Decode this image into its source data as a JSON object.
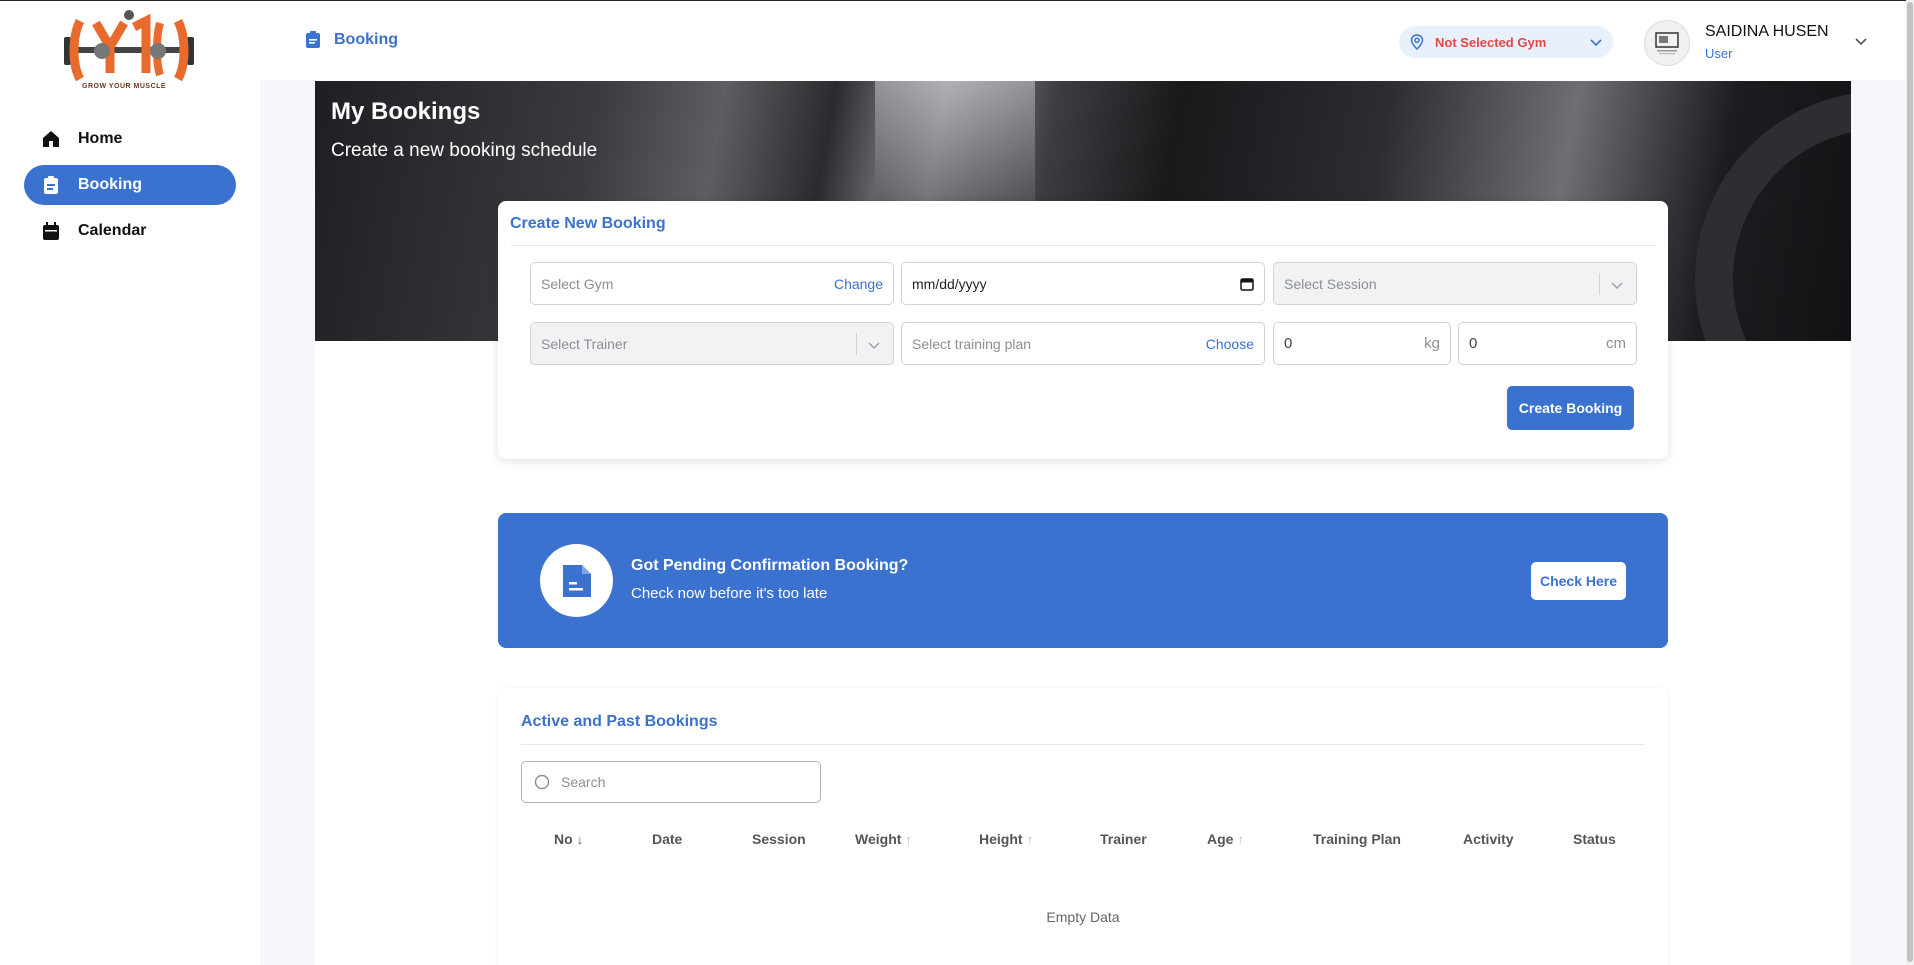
{
  "sidebar": {
    "logo_text": "GROW YOUR MUSCLE",
    "items": [
      {
        "label": "Home",
        "icon": "home-icon",
        "active": false
      },
      {
        "label": "Booking",
        "icon": "clipboard-icon",
        "active": true
      },
      {
        "label": "Calendar",
        "icon": "calendar-icon",
        "active": false
      }
    ]
  },
  "header": {
    "breadcrumb": "Booking",
    "gym_selector": "Not Selected Gym",
    "user_name": "SAIDINA HUSEN",
    "user_role": "User"
  },
  "hero": {
    "title": "My Bookings",
    "subtitle": "Create a new booking schedule"
  },
  "create_form": {
    "title": "Create New Booking",
    "gym_placeholder": "Select Gym",
    "gym_action": "Change",
    "date_placeholder": "mm/dd/yyyy",
    "session_placeholder": "Select Session",
    "trainer_placeholder": "Select Trainer",
    "plan_placeholder": "Select training plan",
    "plan_action": "Choose",
    "weight_value": "0",
    "weight_unit": "kg",
    "height_value": "0",
    "height_unit": "cm",
    "submit_label": "Create Booking"
  },
  "pending_banner": {
    "title": "Got Pending Confirmation Booking?",
    "subtitle": "Check now before it's too late",
    "button_label": "Check Here"
  },
  "bookings": {
    "title": "Active and Past Bookings",
    "search_placeholder": "Search",
    "columns": [
      {
        "label": "No",
        "sort": "desc"
      },
      {
        "label": "Date",
        "sort": ""
      },
      {
        "label": "Session",
        "sort": ""
      },
      {
        "label": "Weight",
        "sort": "asc"
      },
      {
        "label": "Height",
        "sort": "asc"
      },
      {
        "label": "Trainer",
        "sort": ""
      },
      {
        "label": "Age",
        "sort": "asc"
      },
      {
        "label": "Training Plan",
        "sort": ""
      },
      {
        "label": "Activity",
        "sort": ""
      },
      {
        "label": "Status",
        "sort": ""
      }
    ],
    "empty_text": "Empty Data"
  },
  "colors": {
    "accent": "#3b72cf",
    "warning_text": "#e04848"
  }
}
